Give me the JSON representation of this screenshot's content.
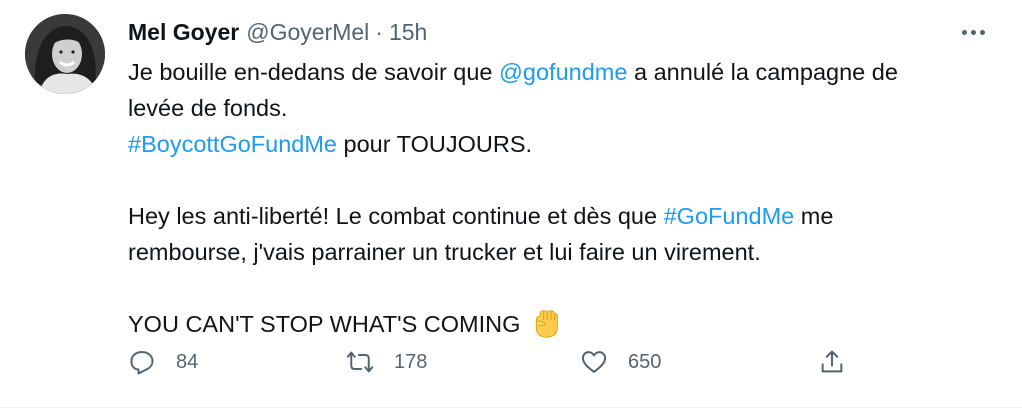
{
  "tweet": {
    "author": {
      "name": "Mel Goyer",
      "handle": "@GoyerMel",
      "separator": "·",
      "time": "15h"
    },
    "body": {
      "line1_prefix": "Je bouille en-dedans de savoir que ",
      "line1_mention": "@gofundme",
      "line1_suffix": " a annulé la campagne de",
      "line2": "levée de fonds.",
      "line3_hashtag": "#BoycottGoFundMe",
      "line3_suffix": " pour TOUJOURS.",
      "line5_prefix": "Hey les anti-liberté! Le combat continue et dès que ",
      "line5_hashtag": "#GoFundMe",
      "line5_suffix": " me",
      "line6": "rembourse, j'vais parrainer un trucker et lui faire un virement.",
      "line8": "YOU CAN'T STOP WHAT'S COMING",
      "emoji": "raised-fist-icon"
    },
    "actions": {
      "reply_count": "84",
      "retweet_count": "178",
      "like_count": "650"
    }
  },
  "colors": {
    "link": "#1d9bf0",
    "text": "#0f1419",
    "secondary": "#536471"
  }
}
